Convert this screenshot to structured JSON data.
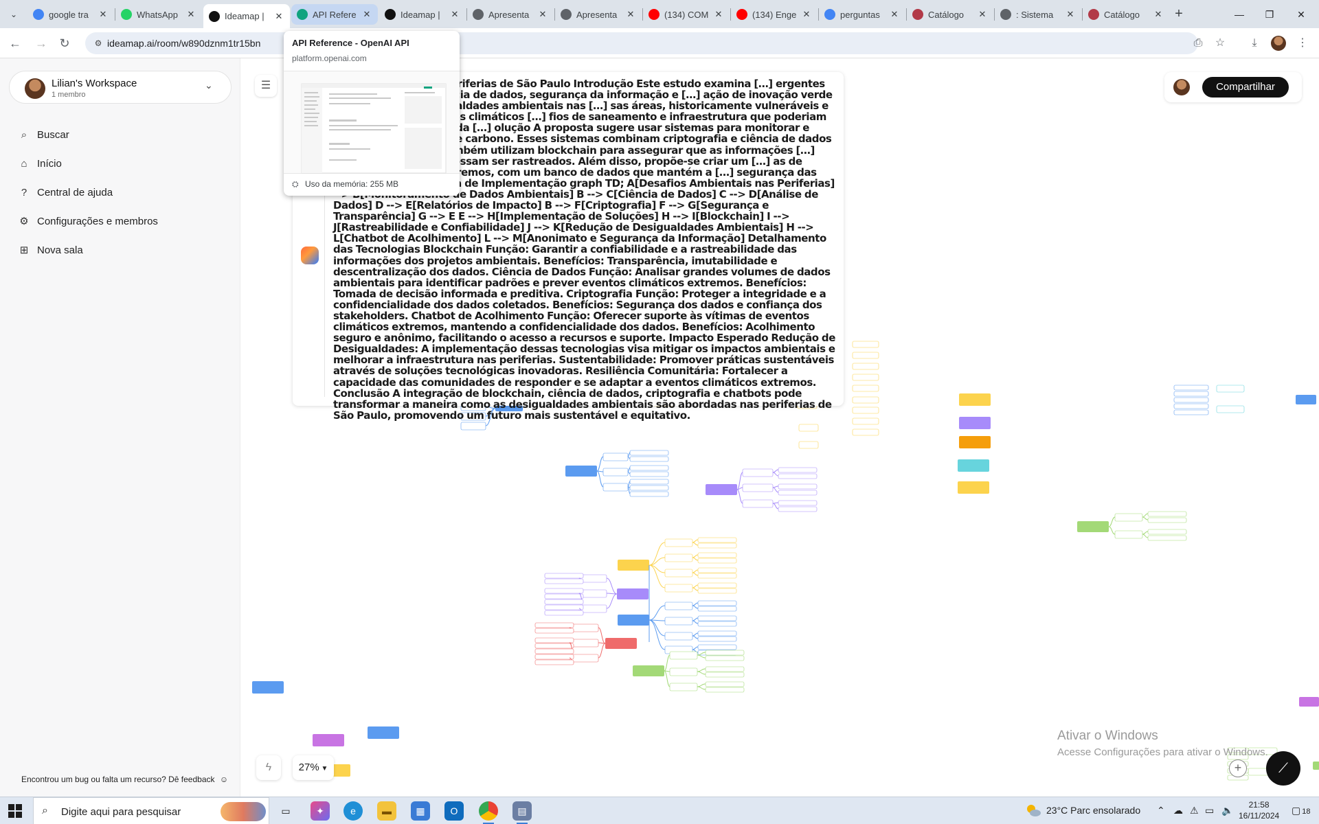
{
  "browser": {
    "tabs": [
      {
        "label": "google tra",
        "favicon": "google-icon",
        "color": "#4285f4"
      },
      {
        "label": "WhatsApp",
        "favicon": "whatsapp-icon",
        "color": "#25d366"
      },
      {
        "label": "Ideamap |",
        "favicon": "ideamap-icon",
        "color": "#111111"
      },
      {
        "label": "API Refere",
        "favicon": "openai-icon",
        "color": "#10a37f"
      },
      {
        "label": "Ideamap |",
        "favicon": "ideamap-icon",
        "color": "#111111"
      },
      {
        "label": "Apresenta",
        "favicon": "globe-icon",
        "color": "#5f6368"
      },
      {
        "label": "Apresenta",
        "favicon": "globe-icon",
        "color": "#5f6368"
      },
      {
        "label": "(134) COM",
        "favicon": "youtube-icon",
        "color": "#ff0000"
      },
      {
        "label": "(134) Enge",
        "favicon": "youtube-icon",
        "color": "#ff0000"
      },
      {
        "label": "perguntas",
        "favicon": "google-docs-icon",
        "color": "#4285f4"
      },
      {
        "label": "Catálogo",
        "favicon": "catalog-icon",
        "color": "#b23a48"
      },
      {
        "label": ": Sistema",
        "favicon": "globe-icon",
        "color": "#5f6368"
      },
      {
        "label": "Catálogo",
        "favicon": "catalog-icon",
        "color": "#b23a48"
      }
    ],
    "active_tab": 2,
    "hovered_tab": 3,
    "address": "ideamap.ai/room/w890dznm1tr15bn",
    "hover_card": {
      "title": "API Reference - OpenAI API",
      "domain": "platform.openai.com",
      "memory": "Uso da memória: 255 MB"
    }
  },
  "sidebar": {
    "workspace_name": "Lilian's Workspace",
    "workspace_members": "1 membro",
    "items": [
      {
        "label": "Buscar",
        "icon": "search-icon"
      },
      {
        "label": "Início",
        "icon": "home-icon"
      },
      {
        "label": "Central de ajuda",
        "icon": "help-icon"
      },
      {
        "label": "Configurações e membros",
        "icon": "gear-icon"
      },
      {
        "label": "Nova sala",
        "icon": "plus-square-icon"
      }
    ],
    "feedback": "Encontrou um bug ou falta um recurso? Dê feedback"
  },
  "canvas": {
    "share_label": "Compartilhar",
    "zoom": "27%",
    "text_card": "Inovação Verde nas Periferias de São Paulo Introdução Este estudo examina […] ergentes como blockchain, ciência de dados, segurança da informação e […] ação de inovação verde para reduzir as desigualdades ambientais nas […] sas áreas, historicamente vulneráveis e impactadas por eventos climáticos […] fios de saneamento e infraestrutura que poderiam ser mitigados através da […] olução A proposta sugere usar sistemas para monitorar e rastrear dados […] o de carbono. Esses sistemas combinam criptografia e ciência de dados para […] ro e claro. Também utilizam blockchain para assegurar que as informações […] projetos ambientais possam ser rastreados. Além disso, propõe-se criar um […] as de eventos climáticos extremos, com um banco de dados que mantém a […] segurança das informações. Diagrama de Implementação graph TD; A[Desafios Ambientais nas Periferias] --> B[Monitoramento de Dados Ambientais] B --> C[Ciência de Dados] C --> D[Análise de Dados] D --> E[Relatórios de Impacto] B --> F[Criptografia] F --> G[Segurança e Transparência] G --> E E --> H[Implementação de Soluções] H --> I[Blockchain] I --> J[Rastreabilidade e Confiabilidade] J --> K[Redução de Desigualdades Ambientais] H --> L[Chatbot de Acolhimento] L --> M[Anonimato e Segurança da Informação] Detalhamento das Tecnologias Blockchain Função: Garantir a confiabilidade e a rastreabilidade das informações dos projetos ambientais. Benefícios: Transparência, imutabilidade e descentralização dos dados. Ciência de Dados Função: Analisar grandes volumes de dados ambientais para identificar padrões e prever eventos climáticos extremos. Benefícios: Tomada de decisão informada e preditiva. Criptografia Função: Proteger a integridade e a confidencialidade dos dados coletados. Benefícios: Segurança dos dados e confiança dos stakeholders. Chatbot de Acolhimento Função: Oferecer suporte às vítimas de eventos climáticos extremos, mantendo a confidencialidade dos dados. Benefícios: Acolhimento seguro e anônimo, facilitando o acesso a recursos e suporte. Impacto Esperado Redução de Desigualdades: A implementação dessas tecnologias visa mitigar os impactos ambientais e melhorar a infraestrutura nas periferias. Sustentabilidade: Promover práticas sustentáveis através de soluções tecnológicas inovadoras. Resiliência Comunitária: Fortalecer a capacidade das comunidades de responder e se adaptar a eventos climáticos extremos. Conclusão A integração de blockchain, ciência de dados, criptografia e chatbots pode transformar a maneira como as desigualdades ambientais são abordadas nas periferias de São Paulo, promovendo um futuro mais sustentável e equitativo.",
    "watermark_title": "Ativar o Windows",
    "watermark_sub": "Acesse Configurações para ativar o Windows."
  },
  "taskbar": {
    "search_placeholder": "Digite aqui para pesquisar",
    "weather": "23°C  Parc ensolarado",
    "time": "21:58",
    "date": "16/11/2024",
    "notifications": "18"
  },
  "colors": {
    "node_blue": "#5b9bf0",
    "node_purple": "#a78bfa",
    "node_yellow": "#fcd34d",
    "node_orange": "#f59e0b",
    "node_green": "#a3d977",
    "node_red": "#ef6b6b",
    "node_teal": "#67d4dd",
    "node_magenta": "#c874e3"
  }
}
